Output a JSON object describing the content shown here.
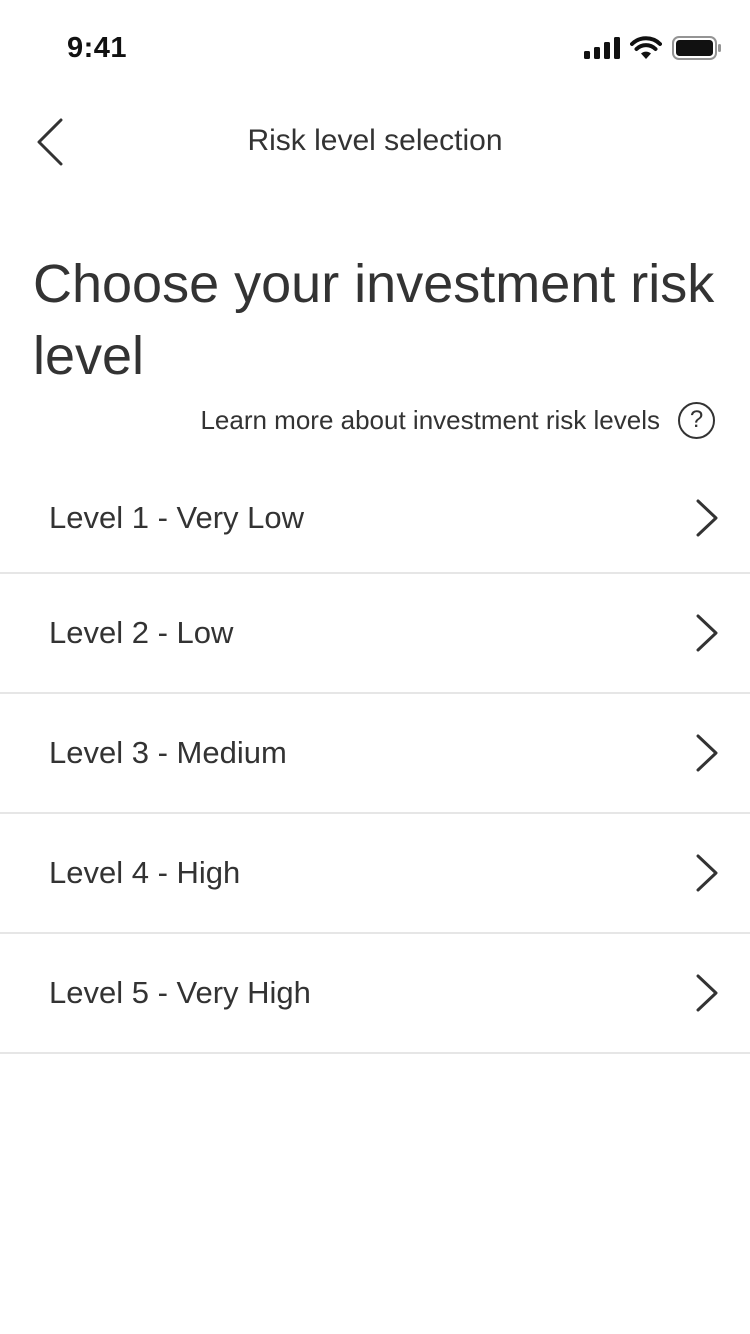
{
  "status_bar": {
    "time": "9:41",
    "icons": [
      "signal-icon",
      "wifi-icon",
      "battery-icon"
    ]
  },
  "nav": {
    "title": "Risk level selection",
    "back_icon": "chevron-left-icon"
  },
  "main": {
    "heading": "Choose your investment risk level",
    "learn_more": "Learn more about investment risk levels",
    "help_icon_glyph": "?"
  },
  "risk_levels": [
    {
      "label": "Level 1 - Very Low"
    },
    {
      "label": "Level 2 - Low"
    },
    {
      "label": "Level 3 - Medium"
    },
    {
      "label": "Level 4 - High"
    },
    {
      "label": "Level 5 - Very High"
    }
  ],
  "colors": {
    "text": "#333333",
    "divider": "#e6e6e6",
    "background": "#ffffff"
  }
}
